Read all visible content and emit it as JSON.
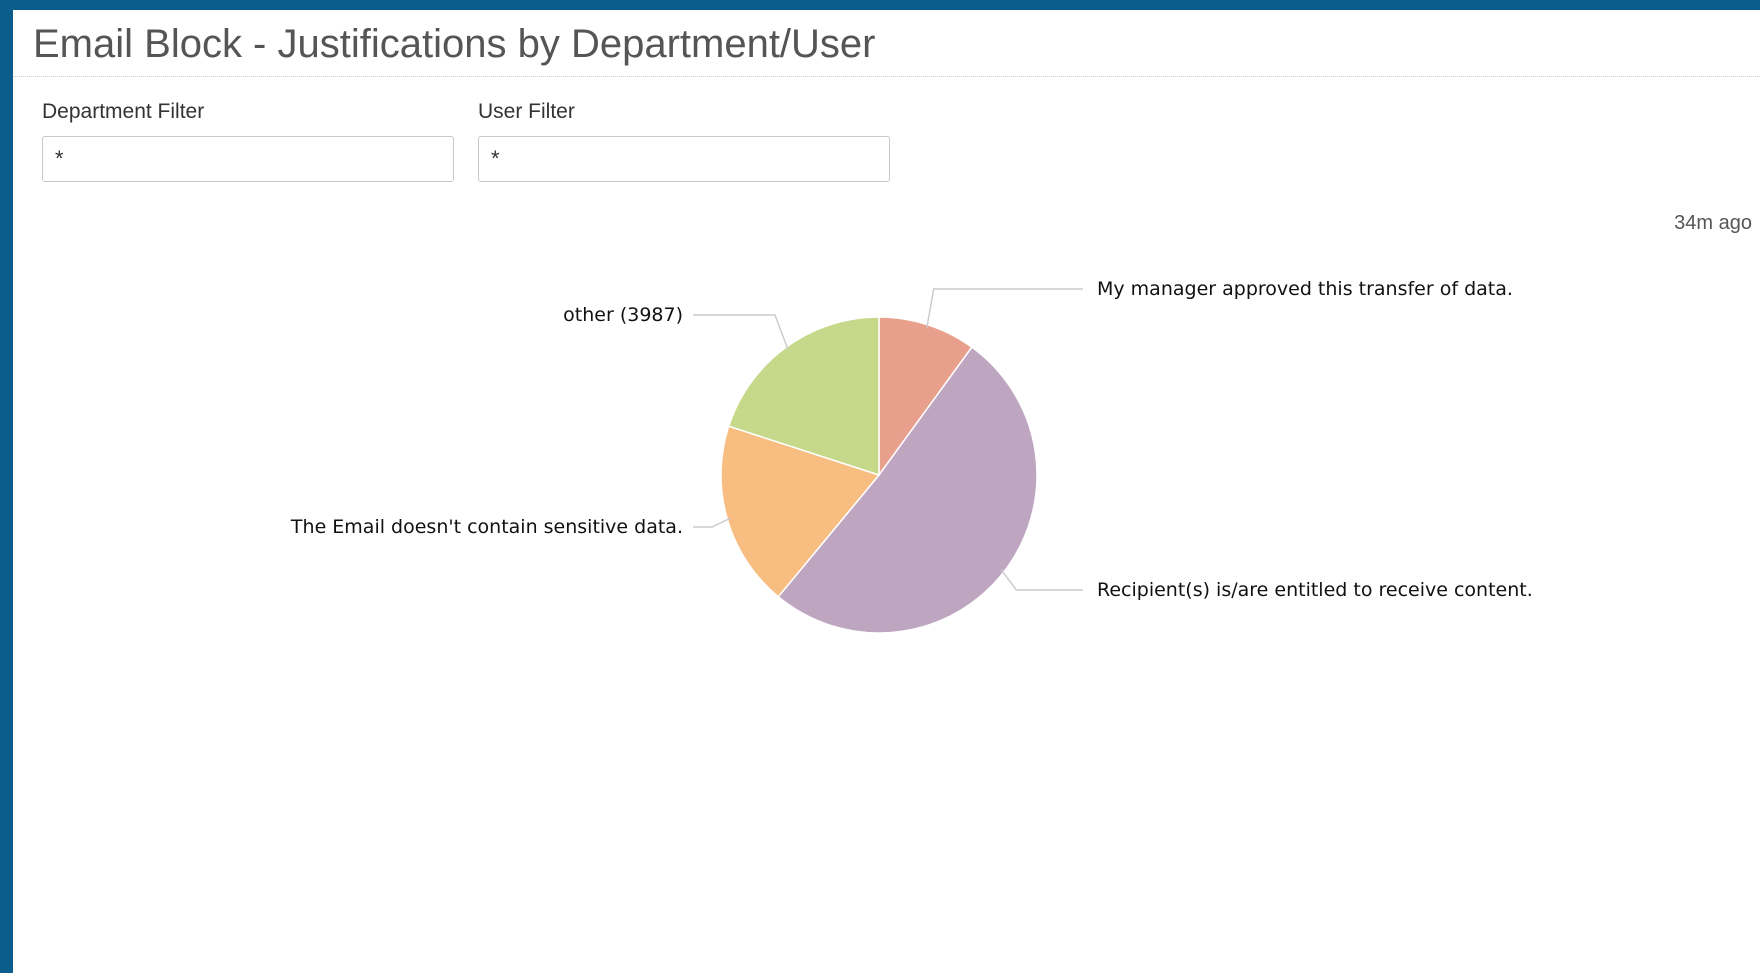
{
  "panel": {
    "title": "Email Block - Justifications by Department/User",
    "last_updated": "34m ago"
  },
  "filters": [
    {
      "label": "Department Filter",
      "value": "*"
    },
    {
      "label": "User Filter",
      "value": "*"
    }
  ],
  "chart_data": {
    "type": "pie",
    "title": "",
    "slices": [
      {
        "label": "My manager approved this transfer of data.",
        "value": 10,
        "color": "#e89f8b"
      },
      {
        "label": "Recipient(s) is/are entitled to receive content.",
        "value": 51,
        "color": "#bea6c1"
      },
      {
        "label": "The Email doesn't contain sensitive data.",
        "value": 19,
        "color": "#f7bd81"
      },
      {
        "label": "other (3987)",
        "value": 20,
        "color": "#c6d98a"
      }
    ],
    "leader_line_color": "#cccccc"
  }
}
